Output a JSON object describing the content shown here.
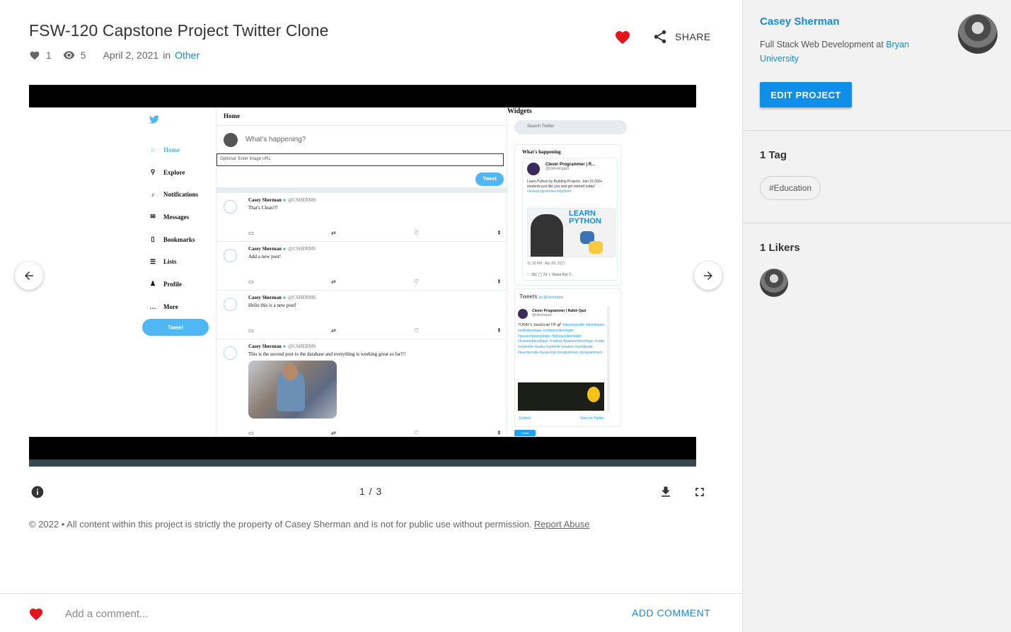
{
  "project": {
    "title": "FSW-120 Capstone Project Twitter Clone",
    "likes": "1",
    "views": "5",
    "date": "April 2, 2021",
    "in_label": "in",
    "category": "Other"
  },
  "actions": {
    "share_label": "SHARE"
  },
  "viewer": {
    "counter": "1 / 3",
    "screenshot": {
      "sidebar": [
        {
          "icon": "home-icon",
          "label": "Home",
          "active": true
        },
        {
          "icon": "search-icon",
          "label": "Explore"
        },
        {
          "icon": "bell-icon",
          "label": "Notifications"
        },
        {
          "icon": "mail-icon",
          "label": "Messages"
        },
        {
          "icon": "bookmark-icon",
          "label": "Bookmarks"
        },
        {
          "icon": "list-icon",
          "label": "Lists"
        },
        {
          "icon": "person-icon",
          "label": "Profile"
        },
        {
          "icon": "more-icon",
          "label": "More"
        }
      ],
      "tweet_button": "Tweet",
      "feed_title": "Home",
      "compose_placeholder": "What's happening?",
      "image_url_placeholder": "Optional: Enter image URL",
      "compose_button": "Tweet",
      "posts": [
        {
          "name": "Casey Sherman",
          "handle": "@CSHERMS",
          "text": "That's Clean!!!"
        },
        {
          "name": "Casey Sherman",
          "handle": "@CSHERMS",
          "text": "Add a new post!"
        },
        {
          "name": "Casey Sherman",
          "handle": "@CSHERMS",
          "text": "Hello this is a new post!"
        },
        {
          "name": "Casey Sherman",
          "handle": "@CSHERMS",
          "text": "This is the second post to the database and everything is working great so far!!!"
        }
      ],
      "widgets_title": "Widgets",
      "widgets_search": "Search Twitter",
      "whats_happening": "What's happening",
      "embed_card": {
        "name": "Clever Programmer | R...",
        "handle": "@cleverqazi",
        "body": "Learn Python by Building Projects. Join 15,000+ students just like you and get started today!",
        "link": "cleverprogrammer.to/python",
        "image_text": "LEARN PYTHON",
        "date": "11:18 PM · Apr 29, 2017",
        "stats": "♡ 281   ◯ 73   ⇪ Share this T..."
      },
      "timeline": {
        "title": "Tweets",
        "by": "by @cleverqazi",
        "name": "Clever Programmer | Rafeh Qazi",
        "handle": "@cleverqazi",
        "lead": "TODAY's JavaScript TIP 🚀",
        "hashtags": "#developerlife #developers #webdeveloper #softwaredeveloper #javascriptdeveloper #fullstackdeveloper #frontenddeveloper #coding #backenddeveloper #code #coderlife #coder #codelife #coders #worldcode #learntocode #javascript #programmer #programmers",
        "embed": "Embed",
        "view_on": "View on Twitter",
        "mini_tweet": "Tweet"
      }
    }
  },
  "footer": {
    "copyright": "© 2022 • All content within this project is strictly the property of Casey Sherman and is not for public use without permission.",
    "report": "Report Abuse"
  },
  "comment": {
    "placeholder": "Add a comment...",
    "submit": "ADD COMMENT"
  },
  "sidebar": {
    "owner": "Casey Sherman",
    "role_prefix": "Full Stack Web Development at",
    "school": "Bryan University",
    "edit_button": "EDIT PROJECT",
    "tags_title": "1 Tag",
    "tags": [
      "#Education"
    ],
    "likers_title": "1 Likers"
  },
  "colors": {
    "accent": "#1a8ad5",
    "button": "#0f8fe8",
    "heart": "#e8141c",
    "twitter": "#50b7f5"
  }
}
